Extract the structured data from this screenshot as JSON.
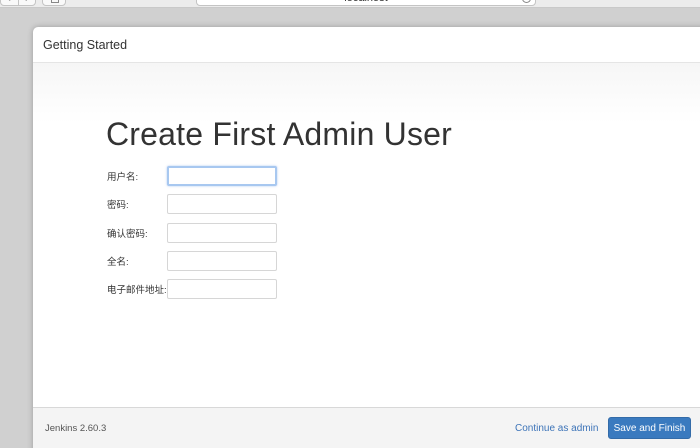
{
  "browser": {
    "url": "localhost",
    "back_glyph": "‹",
    "forward_glyph": "›"
  },
  "panel": {
    "title": "Getting Started"
  },
  "page": {
    "heading": "Create First Admin User"
  },
  "form": {
    "fields": [
      {
        "label": "用户名:",
        "value": ""
      },
      {
        "label": "密码:",
        "value": ""
      },
      {
        "label": "确认密码:",
        "value": ""
      },
      {
        "label": "全名:",
        "value": ""
      },
      {
        "label": "电子邮件地址:",
        "value": ""
      }
    ]
  },
  "footer": {
    "version": "Jenkins 2.60.3",
    "continue_label": "Continue as admin",
    "save_label": "Save and Finish"
  },
  "colors": {
    "primary_button": "#3a7abf",
    "link": "#3d74b8",
    "focus_border": "#a8c8f0"
  }
}
